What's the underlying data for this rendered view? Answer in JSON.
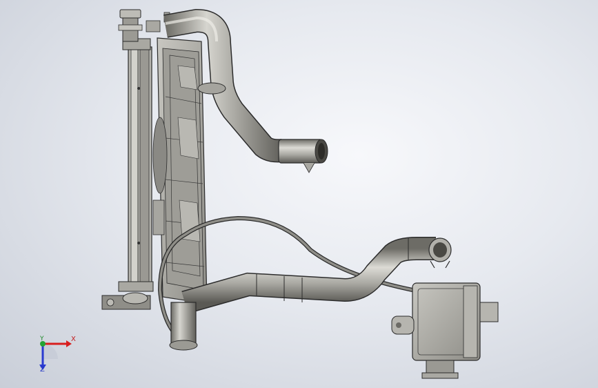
{
  "viewport": {
    "background_top": "#f7f8fb",
    "background_bottom": "#c9ced8",
    "part_color": "#a3a29c",
    "edge_color": "#2b2b2b"
  },
  "triad": {
    "x_label": "X",
    "y_label": "Y",
    "z_label": "Z",
    "x_color": "#d81e1e",
    "y_color": "#24a334",
    "z_color": "#2a3ad0"
  }
}
